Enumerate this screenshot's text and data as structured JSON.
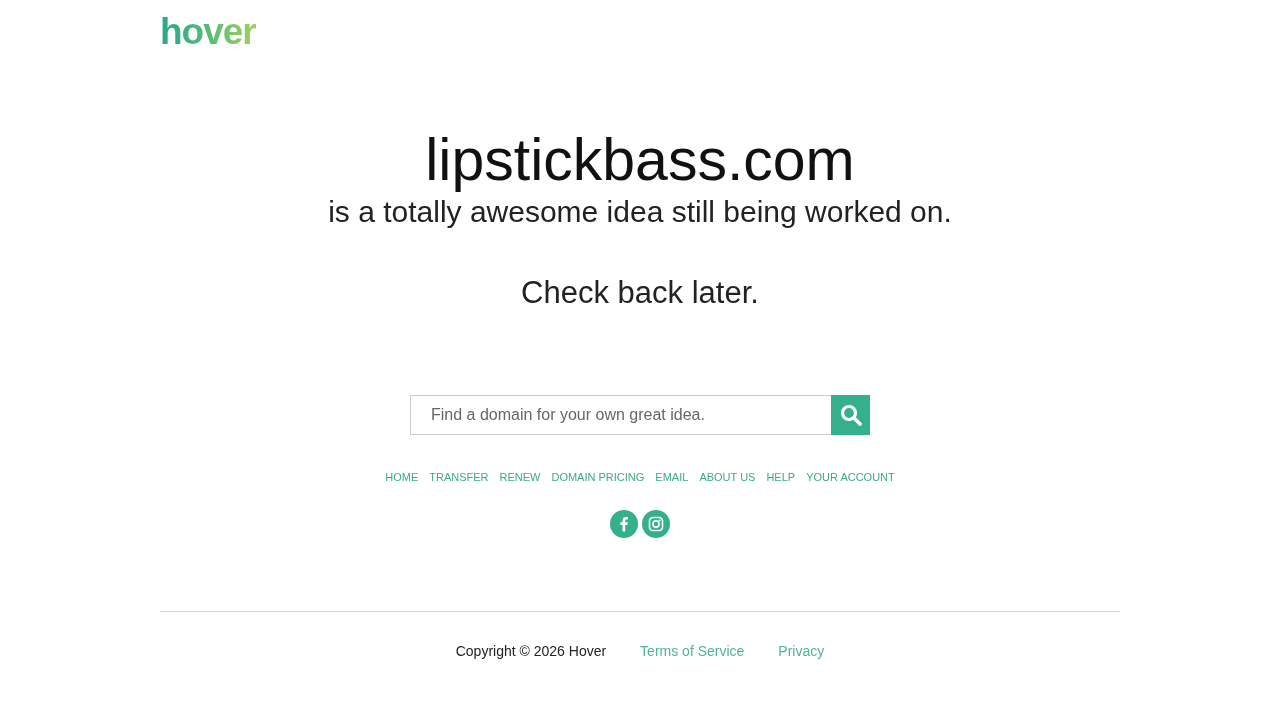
{
  "logo": {
    "text": "hover"
  },
  "hero": {
    "headline": "lipstickbass.com",
    "subheadline": "is a totally awesome idea still being worked on.",
    "note": "Check back later."
  },
  "search": {
    "placeholder": "Find a domain for your own great idea."
  },
  "nav_links": [
    "HOME",
    "TRANSFER",
    "RENEW",
    "DOMAIN PRICING",
    "EMAIL",
    "ABOUT US",
    "HELP",
    "YOUR ACCOUNT"
  ],
  "social_links": [
    {
      "kind": "facebook"
    },
    {
      "kind": "instagram"
    }
  ],
  "footer": {
    "copyright": "Copyright © 2026 Hover",
    "links": [
      "Terms of Service",
      "Privacy"
    ]
  }
}
